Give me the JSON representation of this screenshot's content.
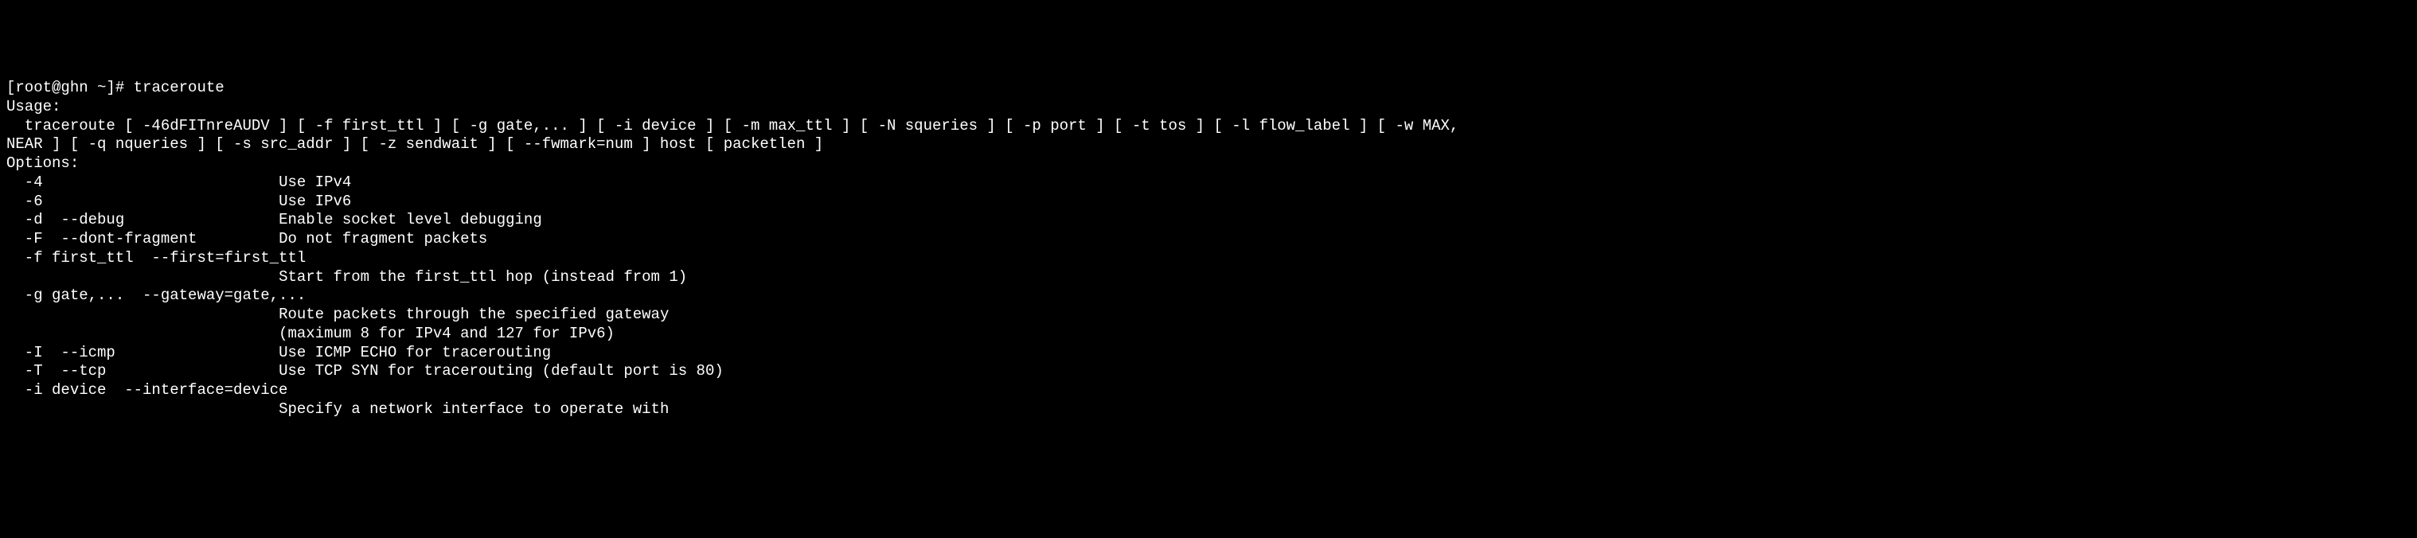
{
  "prompt": "[root@ghn ~]# ",
  "command": "traceroute",
  "usage_label": "Usage:",
  "usage_line1": "  traceroute [ -46dFITnreAUDV ] [ -f first_ttl ] [ -g gate,... ] [ -i device ] [ -m max_ttl ] [ -N squeries ] [ -p port ] [ -t tos ] [ -l flow_label ] [ -w MAX,",
  "usage_line2": "NEAR ] [ -q nqueries ] [ -s src_addr ] [ -z sendwait ] [ --fwmark=num ] host [ packetlen ]",
  "options_label": "Options:",
  "options": [
    {
      "flags": "  -4                          ",
      "desc": "Use IPv4"
    },
    {
      "flags": "  -6                          ",
      "desc": "Use IPv6"
    },
    {
      "flags": "  -d  --debug                 ",
      "desc": "Enable socket level debugging"
    },
    {
      "flags": "  -F  --dont-fragment         ",
      "desc": "Do not fragment packets"
    },
    {
      "flags": "  -f first_ttl  --first=first_ttl",
      "desc": ""
    },
    {
      "flags": "                              ",
      "desc": "Start from the first_ttl hop (instead from 1)"
    },
    {
      "flags": "  -g gate,...  --gateway=gate,...",
      "desc": ""
    },
    {
      "flags": "                              ",
      "desc": "Route packets through the specified gateway"
    },
    {
      "flags": "                              ",
      "desc": "(maximum 8 for IPv4 and 127 for IPv6)"
    },
    {
      "flags": "  -I  --icmp                  ",
      "desc": "Use ICMP ECHO for tracerouting"
    },
    {
      "flags": "  -T  --tcp                   ",
      "desc": "Use TCP SYN for tracerouting (default port is 80)"
    },
    {
      "flags": "  -i device  --interface=device",
      "desc": ""
    },
    {
      "flags": "                              ",
      "desc": "Specify a network interface to operate with"
    }
  ]
}
